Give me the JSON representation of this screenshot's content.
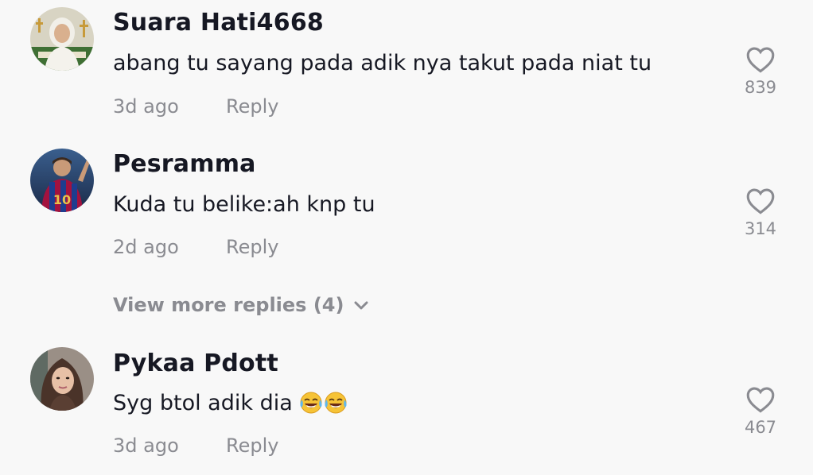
{
  "comments": [
    {
      "username": "Suara Hati4668",
      "text": "abang tu sayang pada adik nya takut pada niat tu",
      "time": "3d ago",
      "reply_label": "Reply",
      "likes": "839"
    },
    {
      "username": "Pesramma",
      "text": "Kuda tu belike:ah knp tu",
      "time": "2d ago",
      "reply_label": "Reply",
      "likes": "314"
    },
    {
      "username": "Pykaa Pdott",
      "text": "Syg btol adik dia",
      "time": "3d ago",
      "reply_label": "Reply",
      "likes": "467",
      "emoji": "😂😂"
    }
  ],
  "view_more_replies": "View more replies (4)",
  "colors": {
    "background": "#f8f8f8",
    "primary_text": "#161823",
    "secondary_text": "#8a8b91"
  },
  "icons": {
    "like": "heart-outline-icon",
    "expand": "chevron-down-icon",
    "emoji": "face-with-tears-of-joy"
  }
}
